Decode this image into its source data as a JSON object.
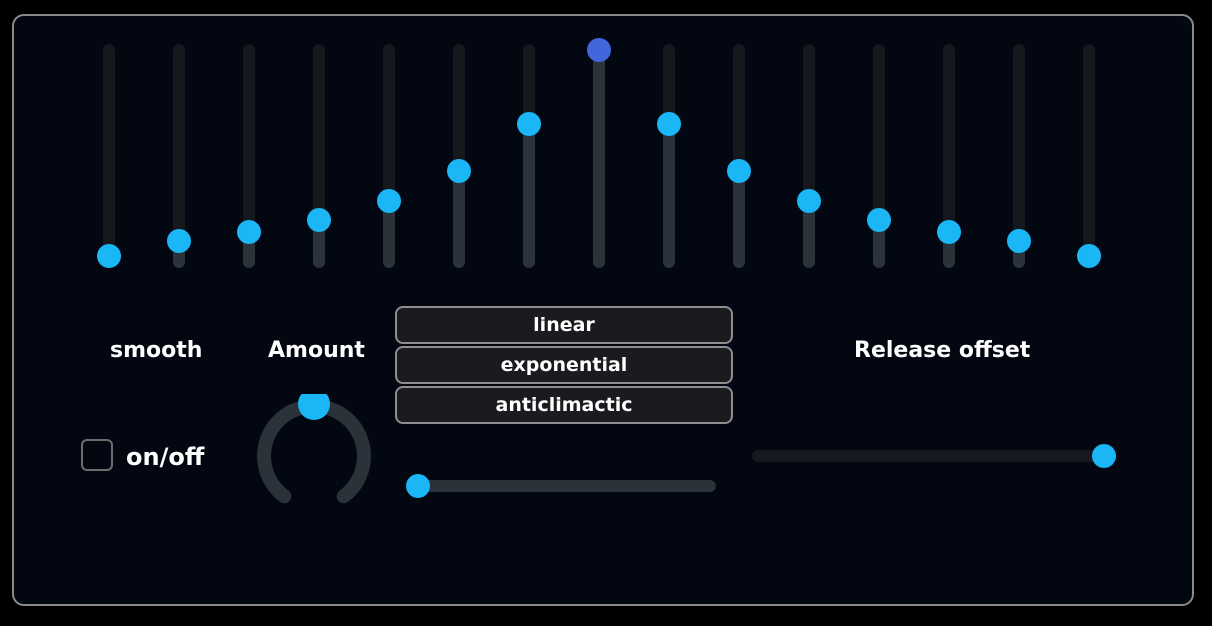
{
  "colors": {
    "background": "#030712",
    "border": "#8a8a8a",
    "accent": "#1ab6f5",
    "accent_active": "#4466dd",
    "track": "#2b3239",
    "track_dark": "#15191d",
    "button_bg": "#1b1b1f",
    "text": "#ffffff"
  },
  "multislider": {
    "values": [
      0.03,
      0.1,
      0.14,
      0.2,
      0.29,
      0.43,
      0.65,
      1.0,
      0.65,
      0.43,
      0.29,
      0.2,
      0.14,
      0.1,
      0.03
    ],
    "active_index": 7
  },
  "smooth": {
    "label": "smooth"
  },
  "toggle": {
    "label": "on/off",
    "checked": false
  },
  "amount": {
    "label": "Amount",
    "value": 0.5
  },
  "modes": {
    "options": [
      "linear",
      "exponential",
      "anticlimactic"
    ]
  },
  "curve_slider": {
    "value": 0.0
  },
  "release": {
    "label": "Release offset",
    "value": 1.0
  }
}
